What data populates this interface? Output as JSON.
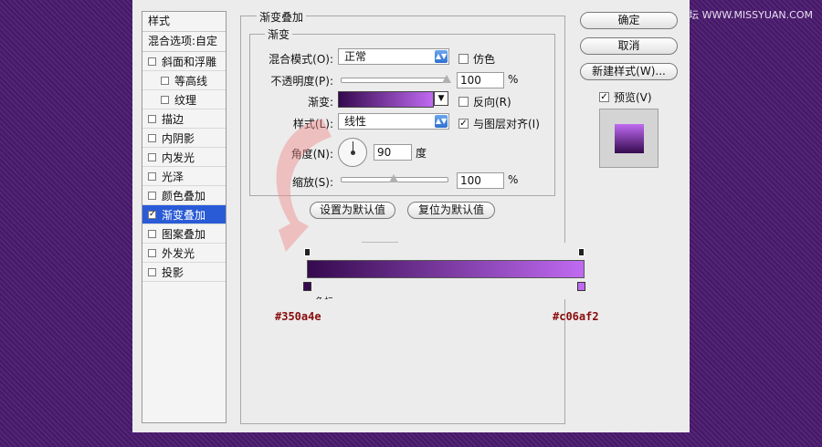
{
  "watermark": "思缘设计论坛 WWW.MISSYUAN.COM",
  "styles_panel": {
    "header": "样式",
    "blend_options": "混合选项:自定",
    "items": [
      {
        "label": "斜面和浮雕",
        "checked": false,
        "sub": false,
        "selected": false
      },
      {
        "label": "等高线",
        "checked": false,
        "sub": true,
        "selected": false
      },
      {
        "label": "纹理",
        "checked": false,
        "sub": true,
        "selected": false
      },
      {
        "label": "描边",
        "checked": false,
        "sub": false,
        "selected": false
      },
      {
        "label": "内阴影",
        "checked": false,
        "sub": false,
        "selected": false
      },
      {
        "label": "内发光",
        "checked": false,
        "sub": false,
        "selected": false
      },
      {
        "label": "光泽",
        "checked": false,
        "sub": false,
        "selected": false
      },
      {
        "label": "颜色叠加",
        "checked": false,
        "sub": false,
        "selected": false
      },
      {
        "label": "渐变叠加",
        "checked": true,
        "sub": false,
        "selected": true
      },
      {
        "label": "图案叠加",
        "checked": false,
        "sub": false,
        "selected": false
      },
      {
        "label": "外发光",
        "checked": false,
        "sub": false,
        "selected": false
      },
      {
        "label": "投影",
        "checked": false,
        "sub": false,
        "selected": false
      }
    ]
  },
  "gradient_overlay": {
    "title": "渐变叠加",
    "section": "渐变",
    "blend_mode_label": "混合模式(O):",
    "blend_mode_value": "正常",
    "dither_label": "仿色",
    "dither_checked": false,
    "opacity_label": "不透明度(P):",
    "opacity_value": "100",
    "opacity_unit": "%",
    "opacity_level": 1.0,
    "gradient_label": "渐变:",
    "reverse_label": "反向(R)",
    "reverse_checked": false,
    "style_label": "样式(L):",
    "style_value": "线性",
    "align_label": "与图层对齐(I)",
    "align_checked": true,
    "angle_label": "角度(N):",
    "angle_value": "90",
    "angle_unit": "度",
    "scale_label": "缩放(S):",
    "scale_value": "100",
    "scale_unit": "%",
    "scale_level": 0.5,
    "make_default": "设置为默认值",
    "reset_default": "复位为默认值"
  },
  "buttons": {
    "ok": "确定",
    "cancel": "取消",
    "new_style": "新建样式(W)...",
    "preview_label": "预览(V)",
    "preview_checked": true
  },
  "gradient_editor": {
    "stop_label": "色标",
    "start_color": "#350a4e",
    "end_color": "#c06af2"
  },
  "colors": {
    "gradient_start": "#350a4e",
    "gradient_end": "#c06af2",
    "selection": "#2a5bd7"
  }
}
